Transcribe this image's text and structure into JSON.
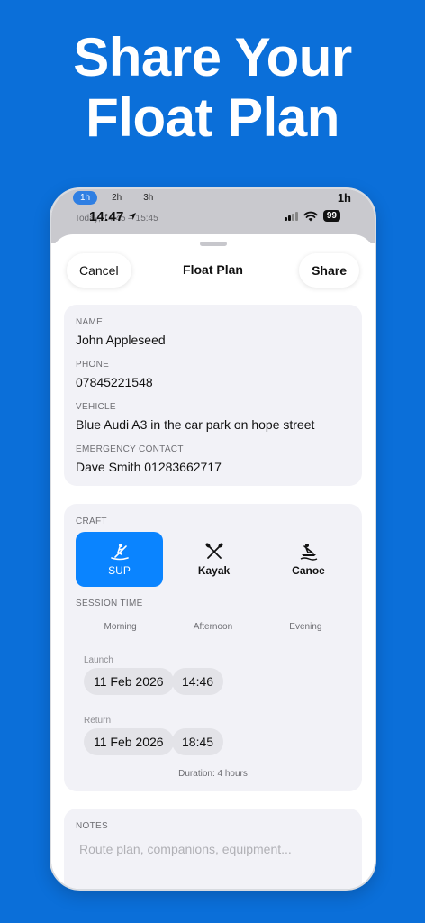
{
  "headline": {
    "line1": "Share Your",
    "line2": "Float Plan"
  },
  "status_bar": {
    "tabs": [
      "1h",
      "2h",
      "3h"
    ],
    "right_label": "1h",
    "faded_date": "Today, 14:45 – 15:45",
    "time": "14:47",
    "battery": "99"
  },
  "nav": {
    "cancel": "Cancel",
    "title": "Float Plan",
    "share": "Share"
  },
  "contact": {
    "name_label": "NAME",
    "name": "John Appleseed",
    "phone_label": "PHONE",
    "phone": "07845221548",
    "vehicle_label": "VEHICLE",
    "vehicle": "Blue Audi A3 in the car park on hope street",
    "emergency_label": "EMERGENCY CONTACT",
    "emergency": "Dave Smith 01283662717"
  },
  "craft": {
    "label": "CRAFT",
    "options": [
      {
        "label": "SUP",
        "icon": "paddleboard-icon",
        "selected": true
      },
      {
        "label": "Kayak",
        "icon": "kayak-paddles-icon",
        "selected": false
      },
      {
        "label": "Canoe",
        "icon": "canoe-icon",
        "selected": false
      }
    ]
  },
  "session": {
    "label": "SESSION TIME",
    "options": [
      "Morning",
      "Afternoon",
      "Evening"
    ],
    "launch_label": "Launch",
    "launch_date": "11 Feb 2026",
    "launch_time": "14:46",
    "return_label": "Return",
    "return_date": "11 Feb 2026",
    "return_time": "18:45",
    "duration": "Duration: 4 hours"
  },
  "notes": {
    "label": "NOTES",
    "placeholder": "Route plan, companions, equipment..."
  },
  "colors": {
    "background": "#0b6fd9",
    "accent": "#0a84ff",
    "card": "#f2f2f7"
  }
}
